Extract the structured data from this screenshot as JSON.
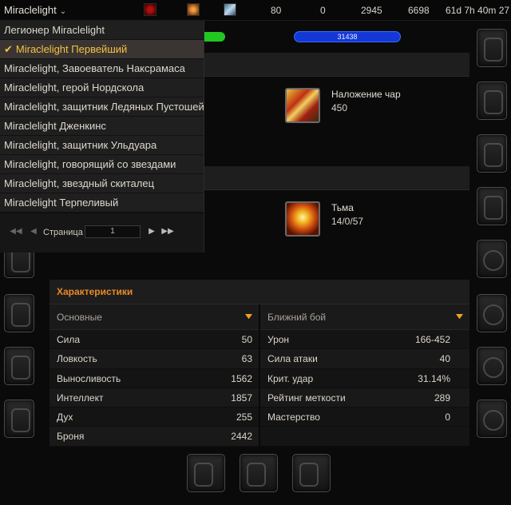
{
  "topbar": {
    "character_name": "Miraclelight",
    "stats": [
      "80",
      "0",
      "2945",
      "6698",
      "61d 7h 40m 27"
    ]
  },
  "bars": {
    "health_fill_fraction": 0.12,
    "mana_value": "31438"
  },
  "titles_dropdown": {
    "items": [
      "Легионер Miraclelight",
      "Miraclelight Первейший",
      "Miraclelight, Завоеватель Наксрамаса",
      "Miraclelight, герой Нордскола",
      "Miraclelight, защитник Ледяных Пустошей",
      "Miraclelight Дженкинс",
      "Miraclelight, защитник Ульдуара",
      "Miraclelight, говорящий со звездами",
      "Miraclelight, звездный скиталец",
      "Miraclelight Терпеливый"
    ],
    "selected_index": 1,
    "pager": {
      "label": "Страница",
      "page_value": "1"
    }
  },
  "professions": [
    {
      "name": "Наложение чар",
      "value": "450",
      "icon": "enchanting-icon"
    },
    {
      "name": "Тьма",
      "value": "14/0/57",
      "icon": "shadow-skull-icon"
    }
  ],
  "stats_panel": {
    "title": "Характеристики",
    "left": {
      "category": "Основные",
      "rows": [
        {
          "name": "Сила",
          "value": "50"
        },
        {
          "name": "Ловкость",
          "value": "63"
        },
        {
          "name": "Выносливость",
          "value": "1562"
        },
        {
          "name": "Интеллект",
          "value": "1857"
        },
        {
          "name": "Дух",
          "value": "255"
        },
        {
          "name": "Броня",
          "value": "2442"
        }
      ]
    },
    "right": {
      "category": "Ближний бой",
      "rows": [
        {
          "name": "Урон",
          "value": "166-452"
        },
        {
          "name": "Сила атаки",
          "value": "40"
        },
        {
          "name": "Крит. удар",
          "value": "31.14%"
        },
        {
          "name": "Рейтинг меткости",
          "value": "289"
        },
        {
          "name": "Мастерство",
          "value": "0"
        }
      ]
    }
  },
  "colors": {
    "accent_orange": "#e88a2a",
    "selected_gold": "#f5c242",
    "health_green": "#22c722",
    "mana_blue": "#1438d6"
  }
}
